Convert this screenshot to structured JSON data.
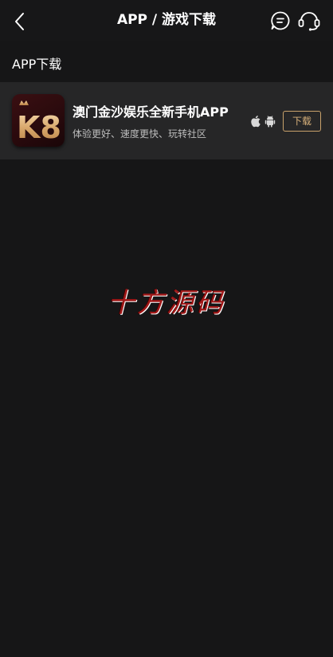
{
  "header": {
    "title": "APP / 游戏下载",
    "back_icon": "chevron-left-icon",
    "chat_icon": "chat-bubble-icon",
    "support_icon": "headset-icon"
  },
  "section": {
    "title": "APP下载"
  },
  "app": {
    "logo_text": "K8",
    "name": "澳门金沙娱乐全新手机APP",
    "description": "体验更好、速度更快、玩转社区",
    "platforms": [
      "apple-icon",
      "android-icon"
    ],
    "download_label": "下载"
  },
  "watermark": {
    "text": "十方源码"
  },
  "colors": {
    "background": "#161617",
    "card": "#262627",
    "accent_gold": "#c9a26b",
    "watermark_red": "#a01818"
  }
}
